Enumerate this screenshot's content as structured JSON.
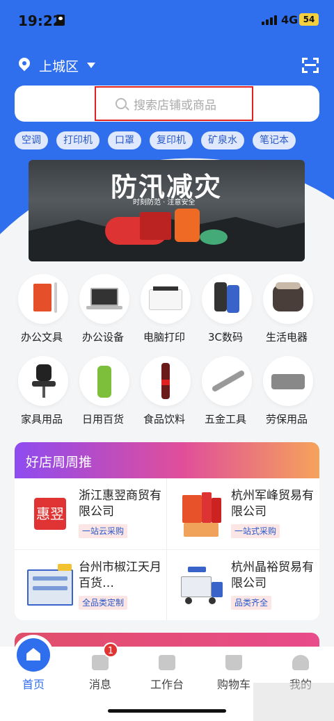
{
  "status_bar": {
    "time": "19:22",
    "network": "4G",
    "battery": "54"
  },
  "header": {
    "location": "上城区"
  },
  "search": {
    "placeholder": "搜索店铺或商品"
  },
  "hot_tags": [
    "空调",
    "打印机",
    "口罩",
    "复印机",
    "矿泉水",
    "笔记本"
  ],
  "banner": {
    "title": "防汛减灾",
    "subtitle": "时刻防范 · 注意安全"
  },
  "categories": [
    {
      "label": "办公文具",
      "icon": "notebook-icon"
    },
    {
      "label": "办公设备",
      "icon": "laptop-icon"
    },
    {
      "label": "电脑打印",
      "icon": "printer-icon"
    },
    {
      "label": "3C数码",
      "icon": "smartphone-icon"
    },
    {
      "label": "生活电器",
      "icon": "rice-cooker-icon"
    },
    {
      "label": "家具用品",
      "icon": "office-chair-icon"
    },
    {
      "label": "日用百货",
      "icon": "shampoo-bottle-icon"
    },
    {
      "label": "食品饮料",
      "icon": "cola-bottle-icon"
    },
    {
      "label": "五金工具",
      "icon": "wrench-icon"
    },
    {
      "label": "劳保用品",
      "icon": "towel-icon"
    }
  ],
  "shops": {
    "title": "好店周周推",
    "items": [
      {
        "name": "浙江惠翌商贸有限公司",
        "tag": "一站云采购",
        "logo_text": "惠翌"
      },
      {
        "name": "杭州军峰贸易有限公司",
        "tag": "一站式采购"
      },
      {
        "name": "台州市椒江天月百货…",
        "tag": "全品类定制"
      },
      {
        "name": "杭州晶裕贸易有限公司",
        "tag": "品类齐全"
      }
    ]
  },
  "tabbar": {
    "items": [
      {
        "label": "首页",
        "icon": "home-icon"
      },
      {
        "label": "消息",
        "icon": "message-icon",
        "badge": "1"
      },
      {
        "label": "工作台",
        "icon": "workbench-icon"
      },
      {
        "label": "购物车",
        "icon": "cart-icon"
      },
      {
        "label": "我的",
        "icon": "user-icon"
      }
    ]
  },
  "colors": {
    "primary": "#2f6fee",
    "highlight_border": "#e02020",
    "badge_red": "#e03434"
  }
}
